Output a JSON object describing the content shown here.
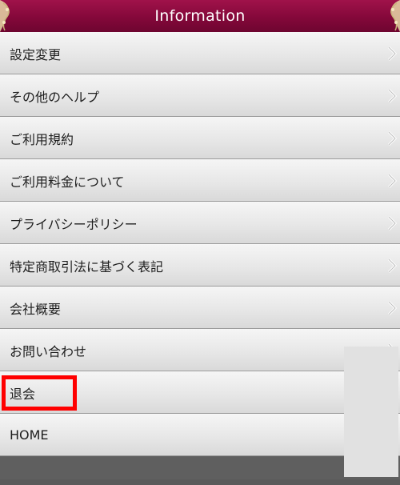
{
  "header": {
    "title": "Information"
  },
  "menu": {
    "items": [
      {
        "label": "設定変更"
      },
      {
        "label": "その他のヘルプ"
      },
      {
        "label": "ご利用規約"
      },
      {
        "label": "ご利用料金について"
      },
      {
        "label": "プライバシーポリシー"
      },
      {
        "label": "特定商取引法に基づく表記"
      },
      {
        "label": "会社概要"
      },
      {
        "label": "お問い合わせ"
      },
      {
        "label": "退会"
      },
      {
        "label": "HOME"
      }
    ]
  },
  "colors": {
    "header_bg": "#84083a",
    "highlight_border": "#ff0000",
    "item_bg": "#e7e7e7"
  }
}
